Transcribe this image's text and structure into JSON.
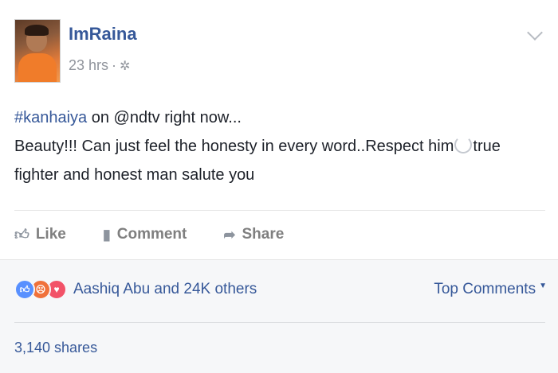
{
  "post": {
    "author": "ImRaina",
    "time": "23 hrs",
    "separator": "·",
    "privacy_icon": "globe-icon",
    "text": {
      "hashtag": "#kanhaiya",
      "line1_rest": " on @ndtv right now...",
      "line2a": "Beauty!!! Can just feel the honesty in every word..Respect him",
      "line2b": "true",
      "line3": "fighter and honest man salute you"
    }
  },
  "actions": {
    "like": "Like",
    "comment": "Comment",
    "share": "Share"
  },
  "reactions": {
    "summary": "Aashiq Abu and 24K others"
  },
  "comments": {
    "sort_label": "Top Comments"
  },
  "shares": {
    "label": "3,140 shares"
  },
  "colors": {
    "link": "#365899",
    "muted": "#90949c"
  }
}
